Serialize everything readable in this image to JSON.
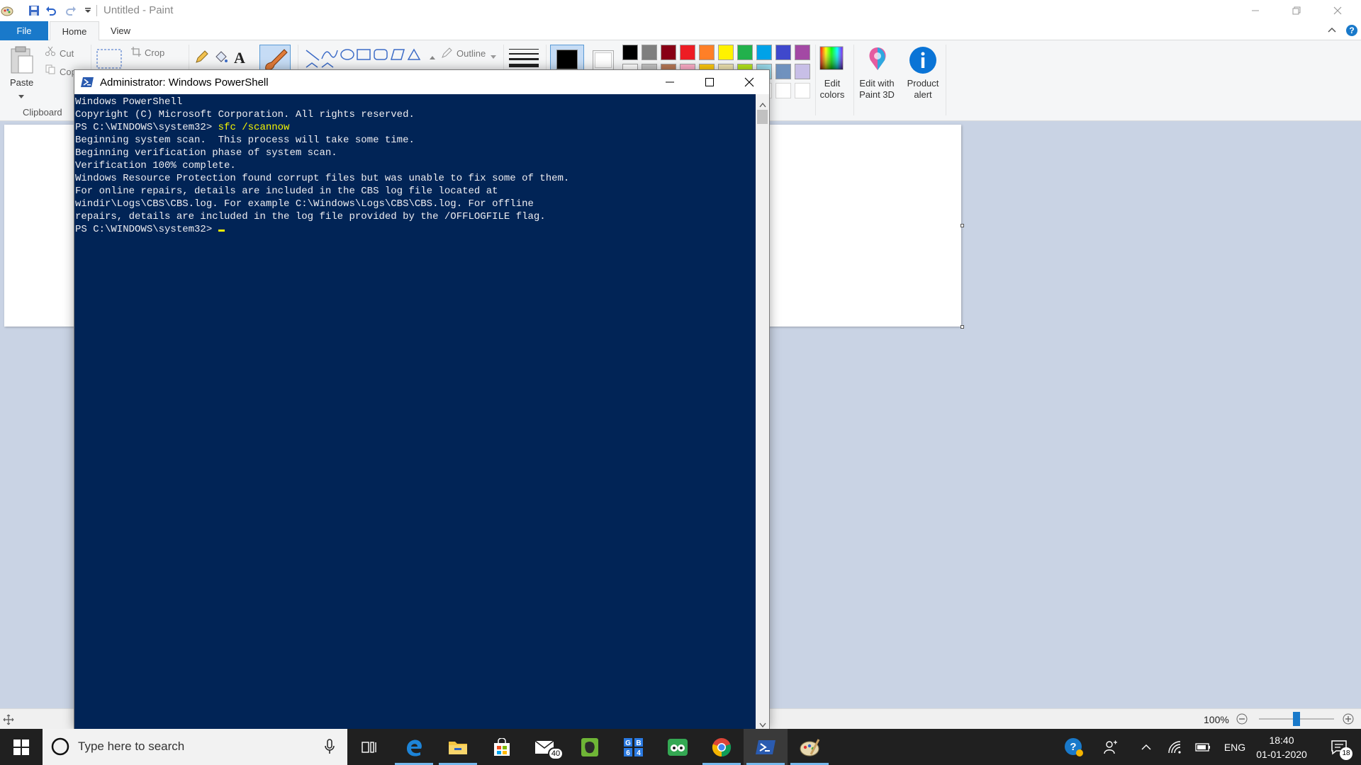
{
  "paint": {
    "title": "Untitled - Paint",
    "tabs": {
      "file": "File",
      "home": "Home",
      "view": "View"
    },
    "ribbon": {
      "paste": "Paste",
      "cut": "Cut",
      "copy": "Cop",
      "crop": "Crop",
      "clipboard_group": "Clipboard",
      "outline": "Outline",
      "edit_colors_l1": "Edit",
      "edit_colors_l2": "colors",
      "edit_paint3d_l1": "Edit with",
      "edit_paint3d_l2": "Paint 3D",
      "product_alert_l1": "Product",
      "product_alert_l2": "alert",
      "palette_row1": [
        "#000000",
        "#7f7f7f",
        "#880015",
        "#ed1c24",
        "#ff7f27",
        "#fff200",
        "#22b14c",
        "#00a2e8",
        "#3f48cc",
        "#a349a4"
      ],
      "palette_row2": [
        "#ffffff",
        "#c3c3c3",
        "#b97a57",
        "#ffaec9",
        "#ffc90e",
        "#efe4b0",
        "#b5e61d",
        "#99d9ea",
        "#7092be",
        "#c8bfe7"
      ],
      "color1": "#000000",
      "color2": "#ffffff"
    },
    "status": {
      "zoom": "100%"
    }
  },
  "powershell": {
    "title": "Administrator: Windows PowerShell",
    "lines": [
      "Windows PowerShell",
      "Copyright (C) Microsoft Corporation. All rights reserved.",
      "",
      "",
      "",
      "Beginning system scan.  This process will take some time.",
      "",
      "Beginning verification phase of system scan.",
      "Verification 100% complete.",
      "",
      "Windows Resource Protection found corrupt files but was unable to fix some of them.",
      "For online repairs, details are included in the CBS log file located at",
      "windir\\Logs\\CBS\\CBS.log. For example C:\\Windows\\Logs\\CBS\\CBS.log. For offline",
      "repairs, details are included in the log file provided by the /OFFLOGFILE flag."
    ],
    "prompt": "PS C:\\WINDOWS\\system32>",
    "command": "sfc /scannow"
  },
  "taskbar": {
    "search_placeholder": "Type here to search",
    "mail_badge": "40",
    "language": "ENG",
    "time": "18:40",
    "date": "01-01-2020",
    "notification_count": "18"
  }
}
